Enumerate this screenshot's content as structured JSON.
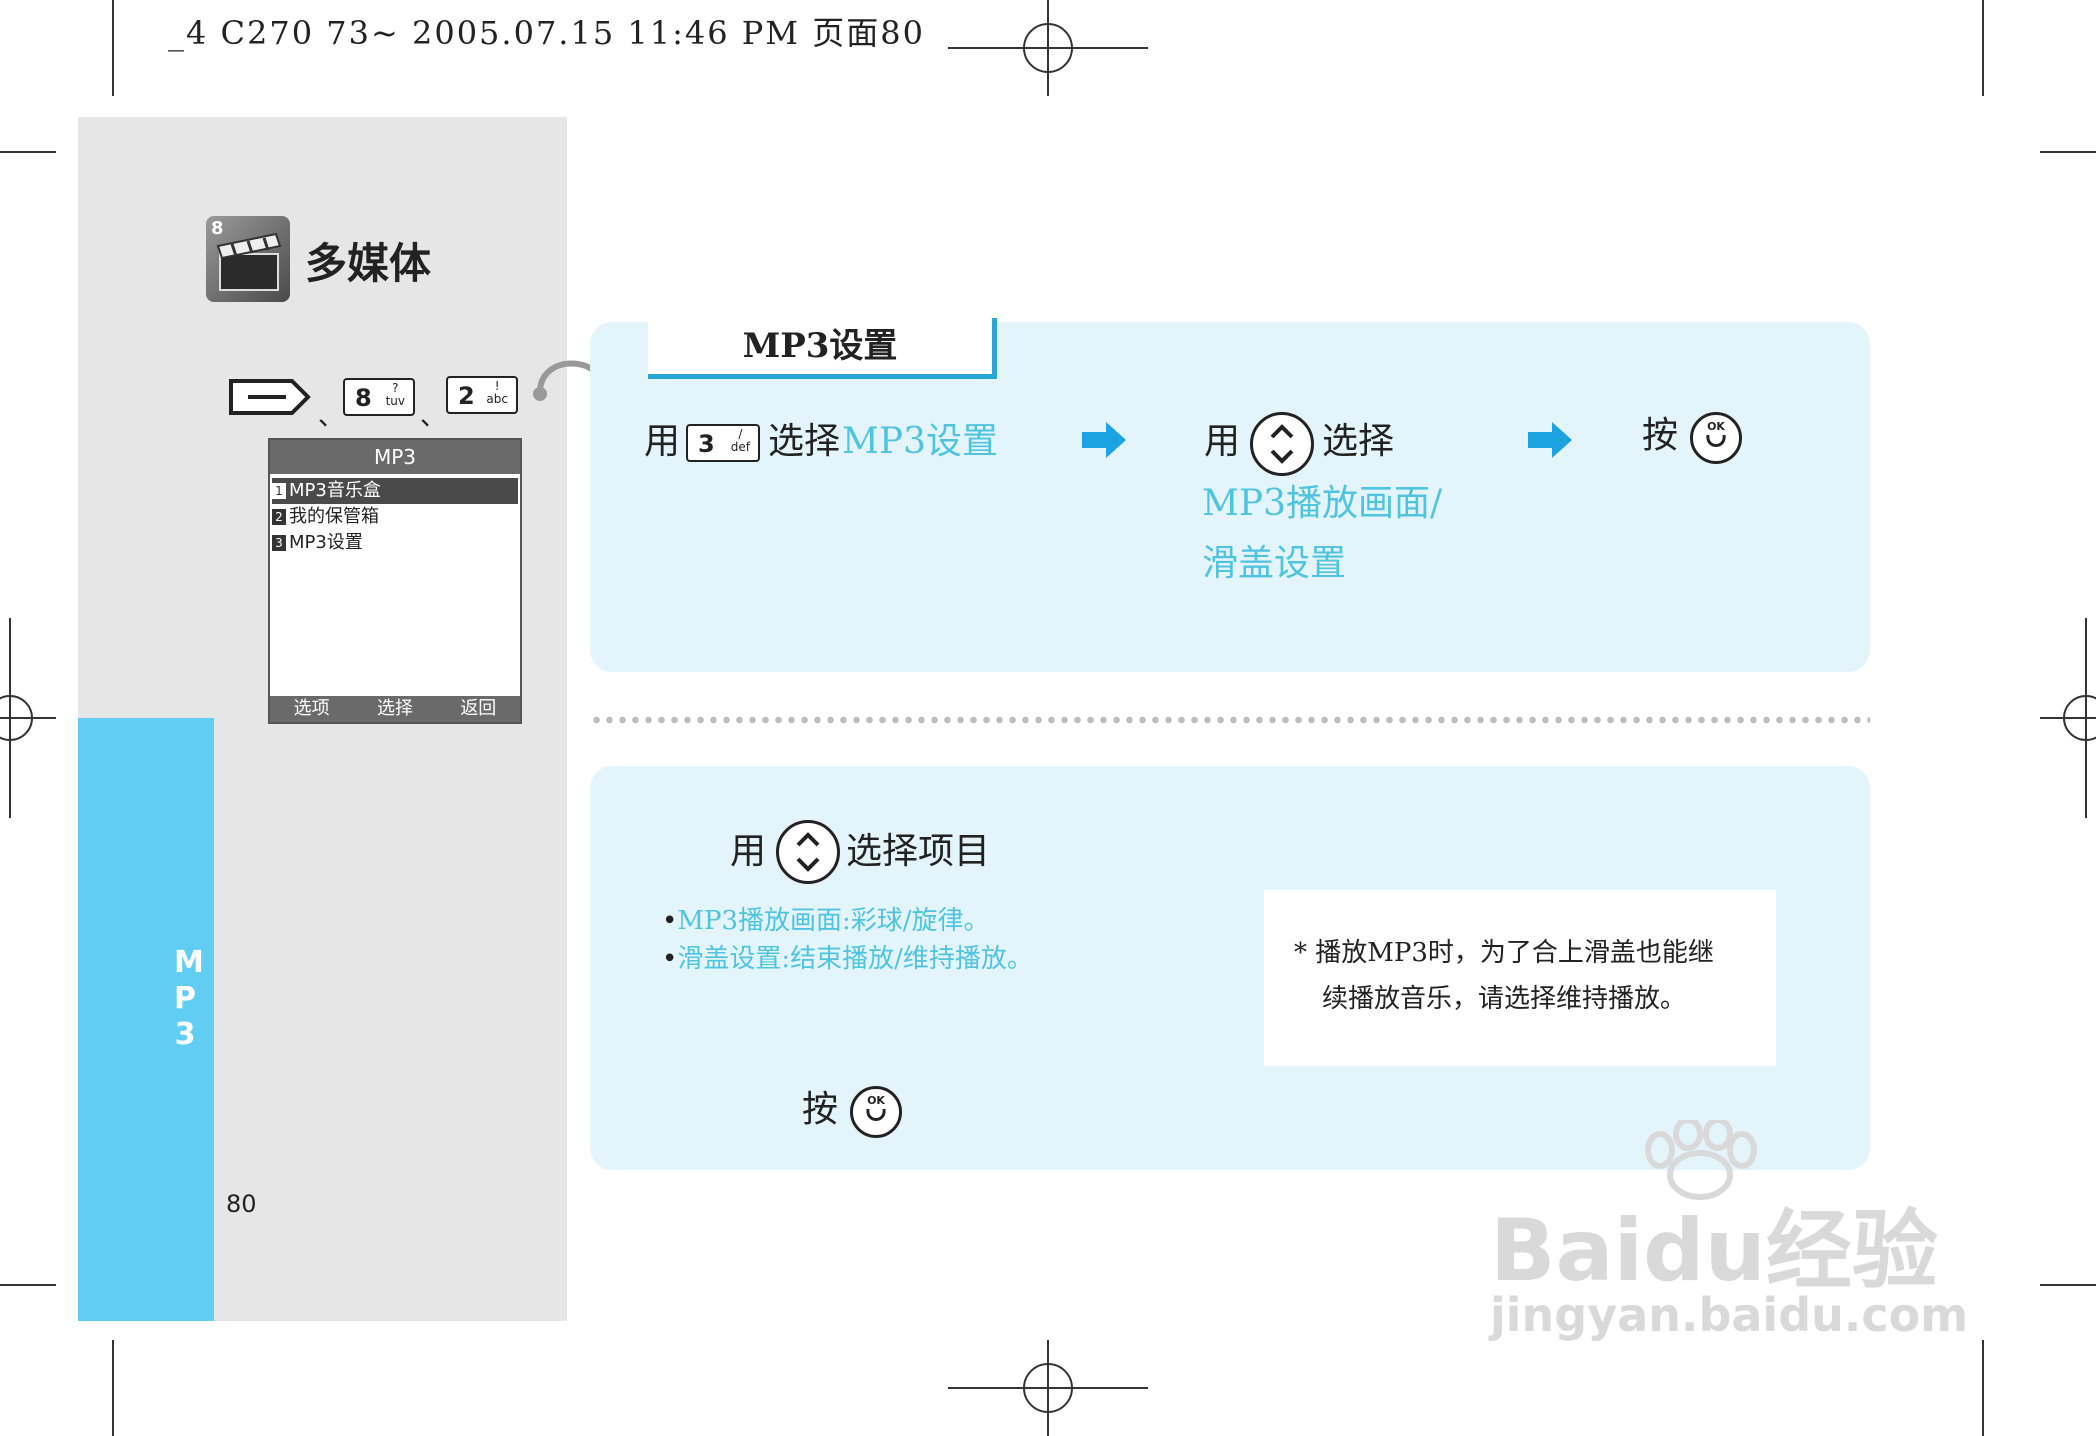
{
  "header_line": "_4 C270 73~ 2005.07.15 11:46 PM 页面80",
  "section": {
    "title": "多媒体",
    "icon_badge": "8",
    "side_tab": "MP3",
    "page_number": "80"
  },
  "keys": {
    "separator": "、",
    "key8": {
      "num": "8",
      "sym": "?",
      "letters": "tuv"
    },
    "key2": {
      "num": "2",
      "sym": "!",
      "letters": "abc"
    },
    "key3": {
      "num": "3",
      "sym": "/",
      "letters": "def"
    }
  },
  "screen": {
    "title": "MP3",
    "items": [
      {
        "index": "1",
        "label": "MP3音乐盒"
      },
      {
        "index": "2",
        "label": "我的保管箱"
      },
      {
        "index": "3",
        "label": "MP3设置"
      }
    ],
    "softkeys": [
      "选项",
      "选择",
      "返回"
    ]
  },
  "top_box": {
    "title": "MP3设置",
    "step1": {
      "prefix": "用",
      "middle": "选择",
      "highlight": "MP3设置"
    },
    "step2": {
      "prefix": "用",
      "middle": "选择",
      "line1": "MP3播放画面/",
      "line2": "滑盖设置"
    },
    "step3": {
      "prefix": "按"
    }
  },
  "bottom_box": {
    "instruction_prefix": "用",
    "instruction_suffix": "选择项目",
    "bullets": [
      {
        "label": "MP3播放画面:",
        "value": "彩球/旋律。"
      },
      {
        "label": "滑盖设置:",
        "value": "结束播放/维持播放。"
      }
    ],
    "press": "按",
    "note_line1": "* 播放MP3时，为了合上滑盖也能继",
    "note_line2": "续播放音乐，请选择维持播放。"
  },
  "ok_label": "OK",
  "watermark": {
    "line1": "Baidu经验",
    "line2": "jingyan.baidu.com"
  },
  "colors": {
    "accent": "#4fc3e0",
    "tab": "#62cdf2",
    "box": "#e3f5fb",
    "arrow": "#1aa3e0"
  }
}
